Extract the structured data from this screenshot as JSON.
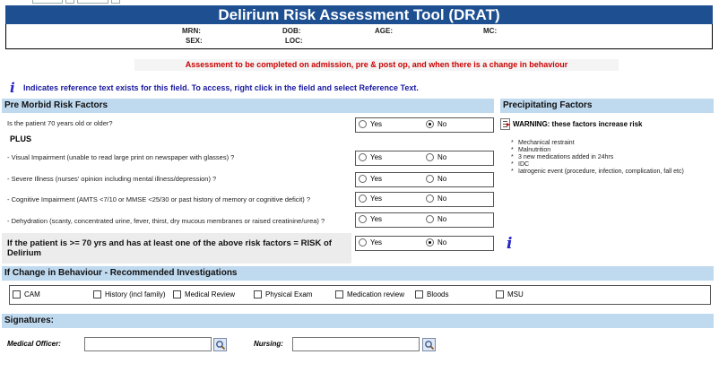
{
  "title": "Delirium Risk Assessment Tool (DRAT)",
  "patient": {
    "mrn_label": "MRN:",
    "dob_label": "DOB:",
    "age_label": "AGE:",
    "mc_label": "MC:",
    "sex_label": "SEX:",
    "loc_label": "LOC:"
  },
  "notice": "Assessment to be completed on admission, pre & post op, and when there is a change in behaviour",
  "reference_note": {
    "icon": "i",
    "text": "Indicates reference text exists for this field. To access, right click in the field and select Reference Text."
  },
  "pre_morbid": {
    "heading": "Pre Morbid Risk Factors",
    "plus_label": "PLUS",
    "questions": [
      {
        "text": "Is the patient 70 years old or older?",
        "selected": "No"
      },
      {
        "text": "- Visual Impairment (unable to read large print on newspaper with glasses) ?",
        "selected": null
      },
      {
        "text": "- Severe Illness (nurses' opinion including mental illness/depression) ?",
        "selected": null
      },
      {
        "text": "- Cognitive Impairment (AMTS <7/10 or MMSE <25/30 or past history of memory or cognitive deficit) ?",
        "selected": null
      },
      {
        "text": "- Dehydration (scanty, concentrated urine, fever, thirst, dry mucous membranes or raised creatinine/urea) ?",
        "selected": null
      }
    ],
    "risk_question": {
      "text": "If the patient is >= 70 yrs and has at least one of the above risk factors = RISK of Delirium",
      "selected": "No"
    },
    "yes_label": "Yes",
    "no_label": "No"
  },
  "precipitating": {
    "heading": "Precipitating Factors",
    "warning": "WARNING: these factors increase risk",
    "bullet": "*",
    "items": [
      "Mechanical restraint",
      "Malnutrition",
      "3 new medications added in 24hrs",
      "IDC",
      "Iatrogenic event (procedure, infection, complication, fall etc)"
    ]
  },
  "investigations": {
    "heading": "If Change in Behaviour - Recommended Investigations",
    "options": [
      "CAM",
      "History (incl family)",
      "Medical Review",
      "Physical Exam",
      "Medication review",
      "Bloods",
      "MSU"
    ]
  },
  "signatures": {
    "heading": "Signatures:",
    "medical_officer_label": "Medical Officer:",
    "nursing_label": "Nursing:"
  },
  "colors": {
    "banner": "#1d4f91",
    "section": "#bfd9ef",
    "notice_text": "#cc0000",
    "reference_text": "#1a1aa0"
  }
}
